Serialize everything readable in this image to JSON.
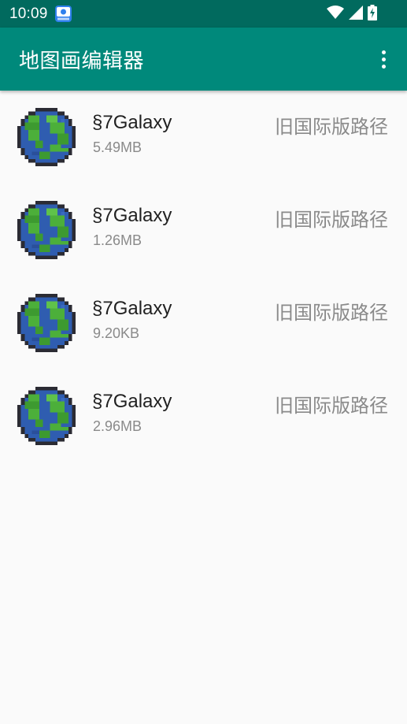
{
  "status_bar": {
    "time": "10:09",
    "notification_icon": "app-notification-icon",
    "wifi_icon": "wifi-icon",
    "signal_icon": "cell-signal-icon",
    "battery_icon": "battery-charging-icon"
  },
  "app_bar": {
    "title": "地图画编辑器",
    "menu_icon": "more-vert-icon"
  },
  "worlds": [
    {
      "name": "§7Galaxy",
      "size": "5.49MB",
      "type": "旧国际版路径",
      "icon": "globe-icon"
    },
    {
      "name": "§7Galaxy",
      "size": "1.26MB",
      "type": "旧国际版路径",
      "icon": "globe-icon"
    },
    {
      "name": "§7Galaxy",
      "size": "9.20KB",
      "type": "旧国际版路径",
      "icon": "globe-icon"
    },
    {
      "name": "§7Galaxy",
      "size": "2.96MB",
      "type": "旧国际版路径",
      "icon": "globe-icon"
    }
  ],
  "colors": {
    "status_bar": "#016a5e",
    "app_bar": "#00897b",
    "background": "#fafafa"
  }
}
